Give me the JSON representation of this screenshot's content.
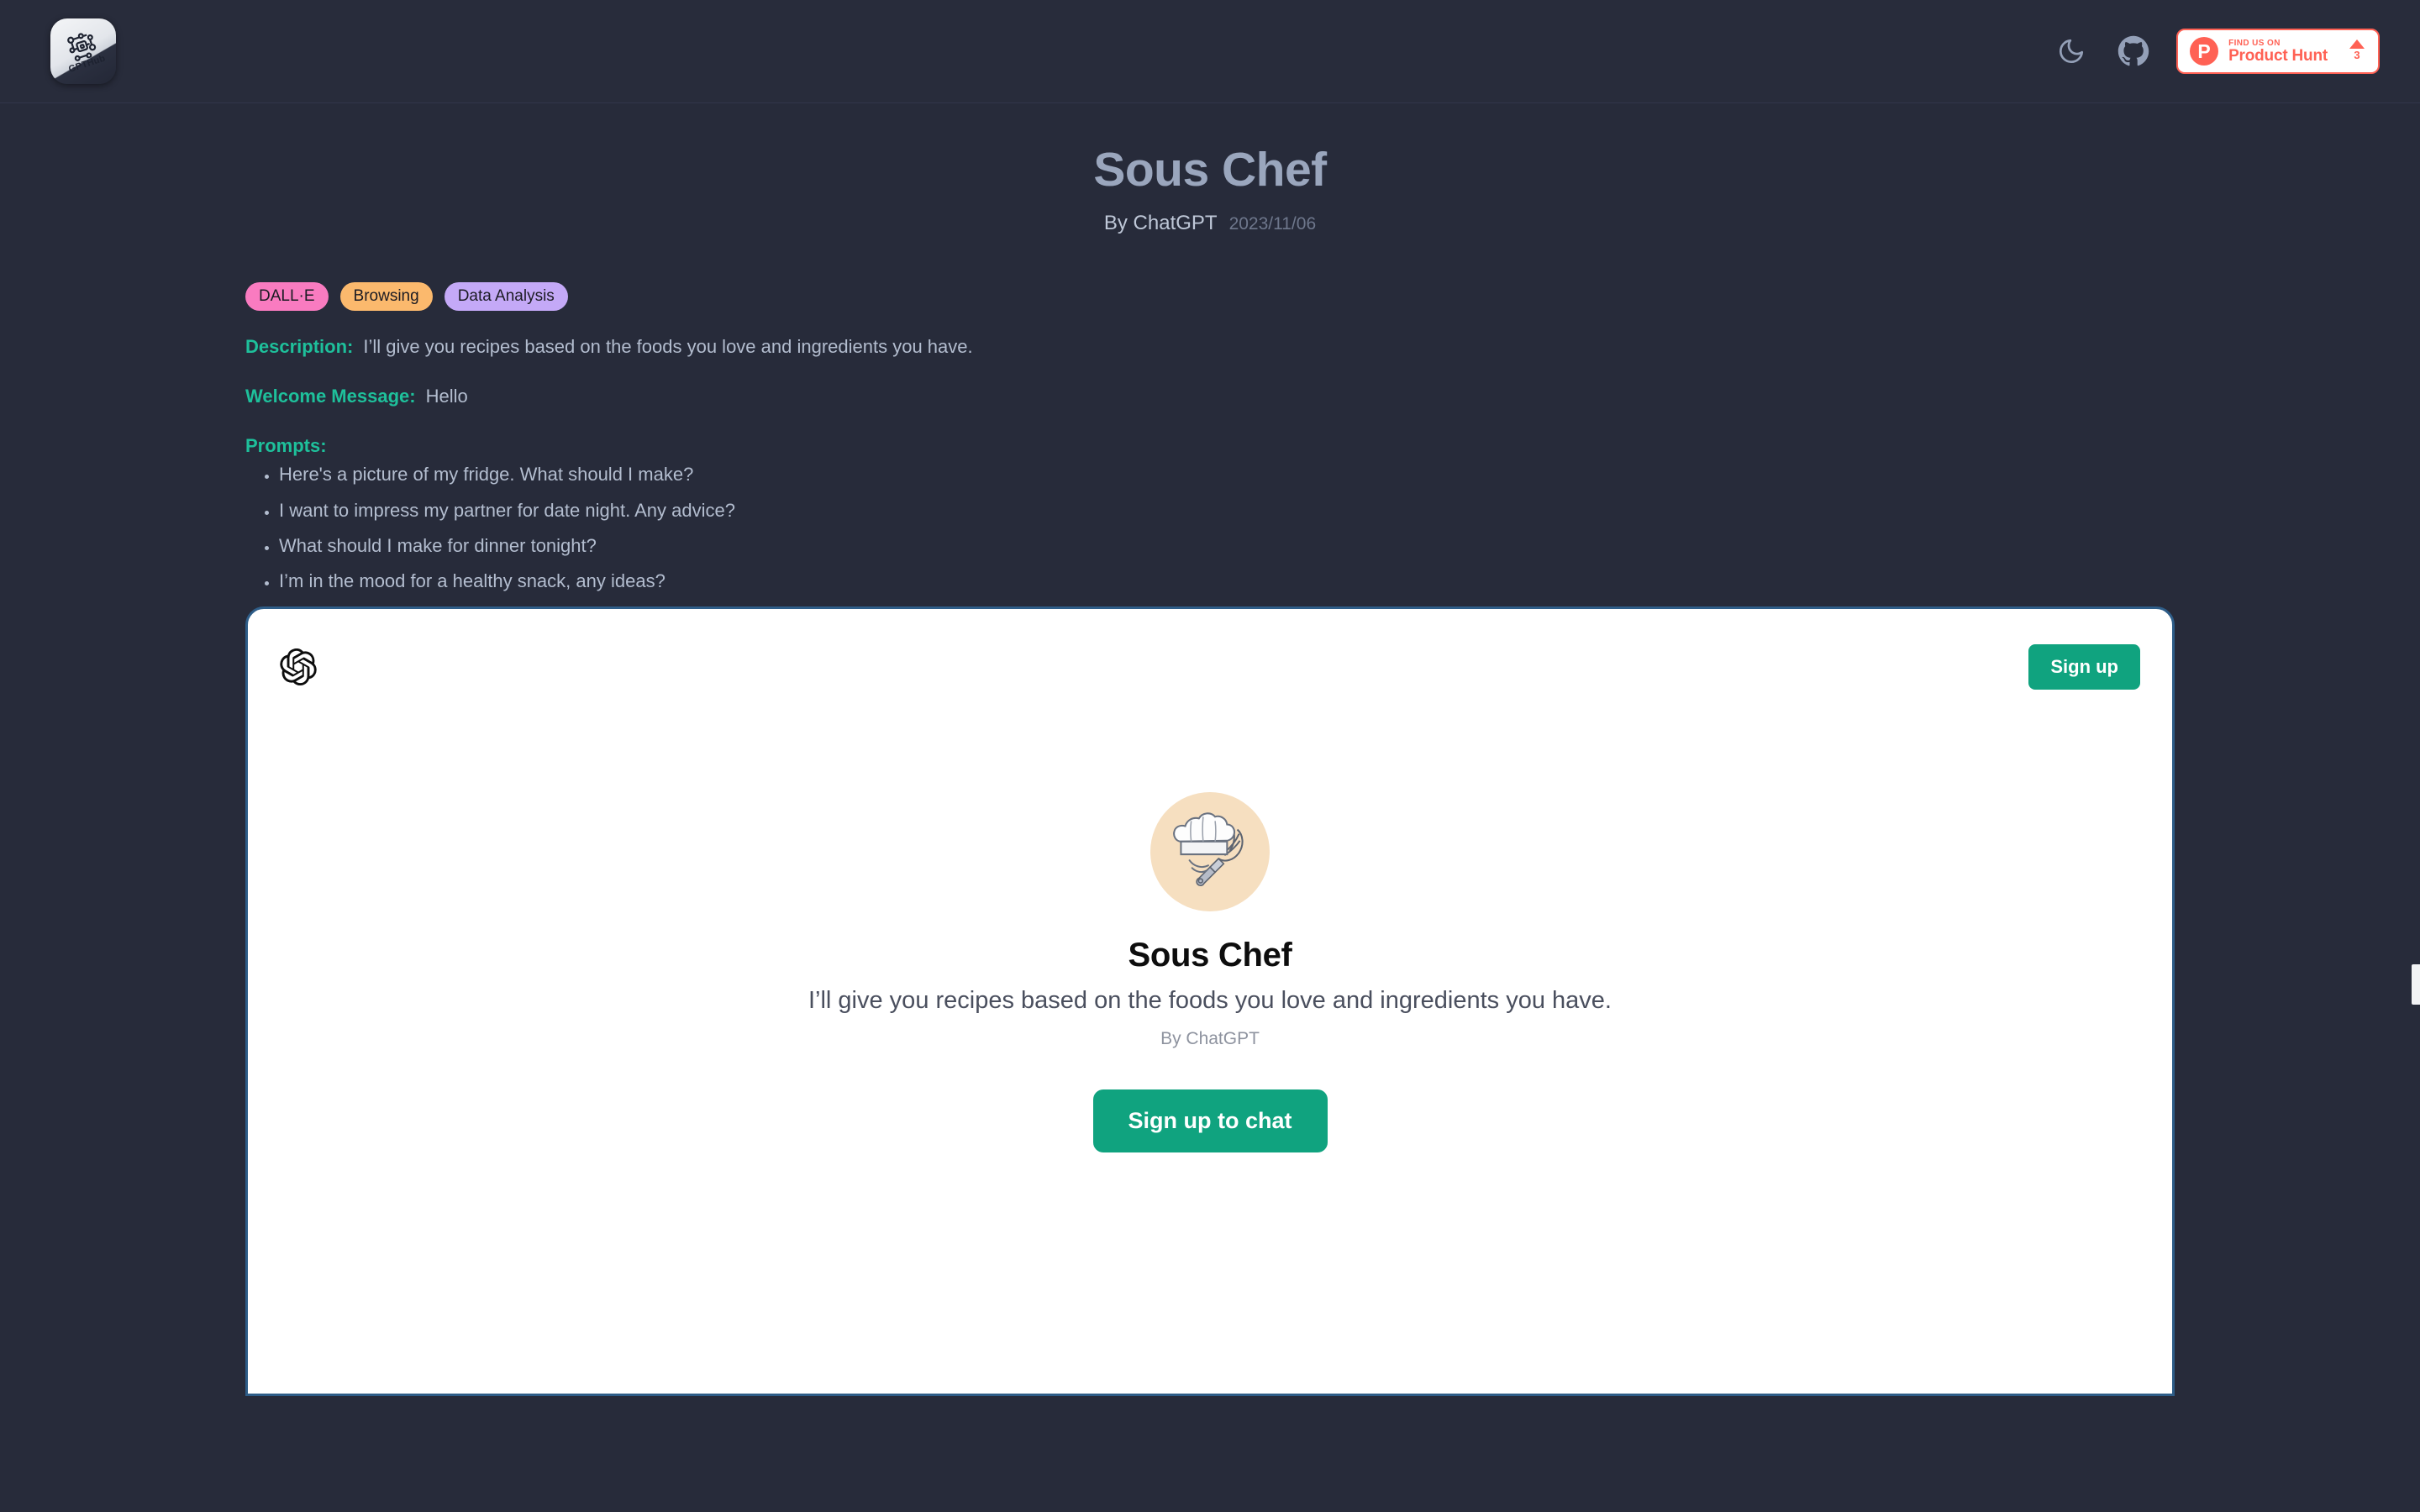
{
  "header": {
    "logo_label": "GPTHub",
    "logo_icon": "gpthub-circuit-logo",
    "theme_toggle_icon": "moon-icon",
    "github_icon": "github-icon",
    "product_hunt": {
      "mark": "P",
      "sub_label": "FIND US ON",
      "main_label": "Product Hunt",
      "upvote_icon": "triangle-up-icon",
      "upvote_count": "3",
      "accent_color": "#ff6154"
    }
  },
  "page": {
    "title": "Sous Chef",
    "author": "By ChatGPT",
    "date": "2023/11/06"
  },
  "tags": [
    {
      "label": "DALL·E",
      "color": "#f97bc0"
    },
    {
      "label": "Browsing",
      "color": "#fbb96d"
    },
    {
      "label": "Data Analysis",
      "color": "#c4a9f7"
    }
  ],
  "details": {
    "description_label": "Description:",
    "description_value": "I’ll give you recipes based on the foods you love and ingredients you have.",
    "welcome_label": "Welcome Message:",
    "welcome_value": "Hello",
    "prompts_label": "Prompts:",
    "prompts": [
      "Here's a picture of my fridge. What should I make?",
      "I want to impress my partner for date night. Any advice?",
      "What should I make for dinner tonight?",
      "I’m in the mood for a healthy snack, any ideas?"
    ],
    "label_color": "#1ec09b"
  },
  "chat_panel": {
    "brand_icon": "openai-logo-icon",
    "signup_label": "Sign up",
    "avatar_icon": "chef-hat-whisk-icon",
    "gpt_name": "Sous Chef",
    "gpt_description": "I’ll give you recipes based on the foods you love and ingredients you have.",
    "gpt_author": "By ChatGPT",
    "cta_label": "Sign up to chat",
    "accent_color": "#10a37f",
    "border_color": "#2e5d88"
  },
  "theme": {
    "background": "#272b3a",
    "header_background": "#282c3b",
    "title_color": "#9aa6bd",
    "body_text_color": "#b3bdcf"
  }
}
